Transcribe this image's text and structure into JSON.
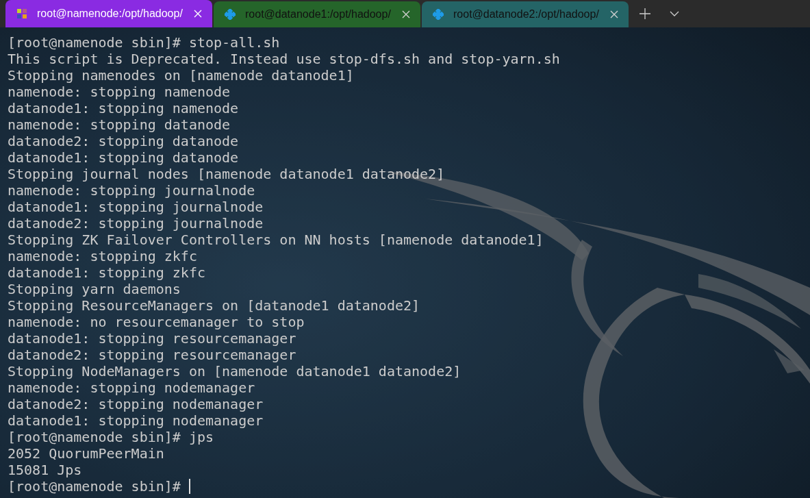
{
  "tabs": [
    {
      "title": "root@namenode:/opt/hadoop/",
      "selected": true,
      "color": "#8a2be2",
      "kind": "grid"
    },
    {
      "title": "root@datanode1:/opt/hadoop/",
      "selected": false,
      "color": "#25652a",
      "kind": "flake"
    },
    {
      "title": "root@datanode2:/opt/hadoop/",
      "selected": false,
      "color": "#246466",
      "kind": "flake"
    }
  ],
  "terminal": {
    "lines": [
      "[root@namenode sbin]# stop-all.sh",
      "This script is Deprecated. Instead use stop-dfs.sh and stop-yarn.sh",
      "Stopping namenodes on [namenode datanode1]",
      "namenode: stopping namenode",
      "datanode1: stopping namenode",
      "namenode: stopping datanode",
      "datanode2: stopping datanode",
      "datanode1: stopping datanode",
      "Stopping journal nodes [namenode datanode1 datanode2]",
      "namenode: stopping journalnode",
      "datanode1: stopping journalnode",
      "datanode2: stopping journalnode",
      "Stopping ZK Failover Controllers on NN hosts [namenode datanode1]",
      "namenode: stopping zkfc",
      "datanode1: stopping zkfc",
      "Stopping yarn daemons",
      "Stopping ResourceManagers on [datanode1 datanode2]",
      "namenode: no resourcemanager to stop",
      "datanode1: stopping resourcemanager",
      "datanode2: stopping resourcemanager",
      "Stopping NodeManagers on [namenode datanode1 datanode2]",
      "namenode: stopping nodemanager",
      "datanode2: stopping nodemanager",
      "datanode1: stopping nodemanager",
      "[root@namenode sbin]# jps",
      "2052 QuorumPeerMain",
      "15081 Jps"
    ],
    "prompt": "[root@namenode sbin]#"
  }
}
